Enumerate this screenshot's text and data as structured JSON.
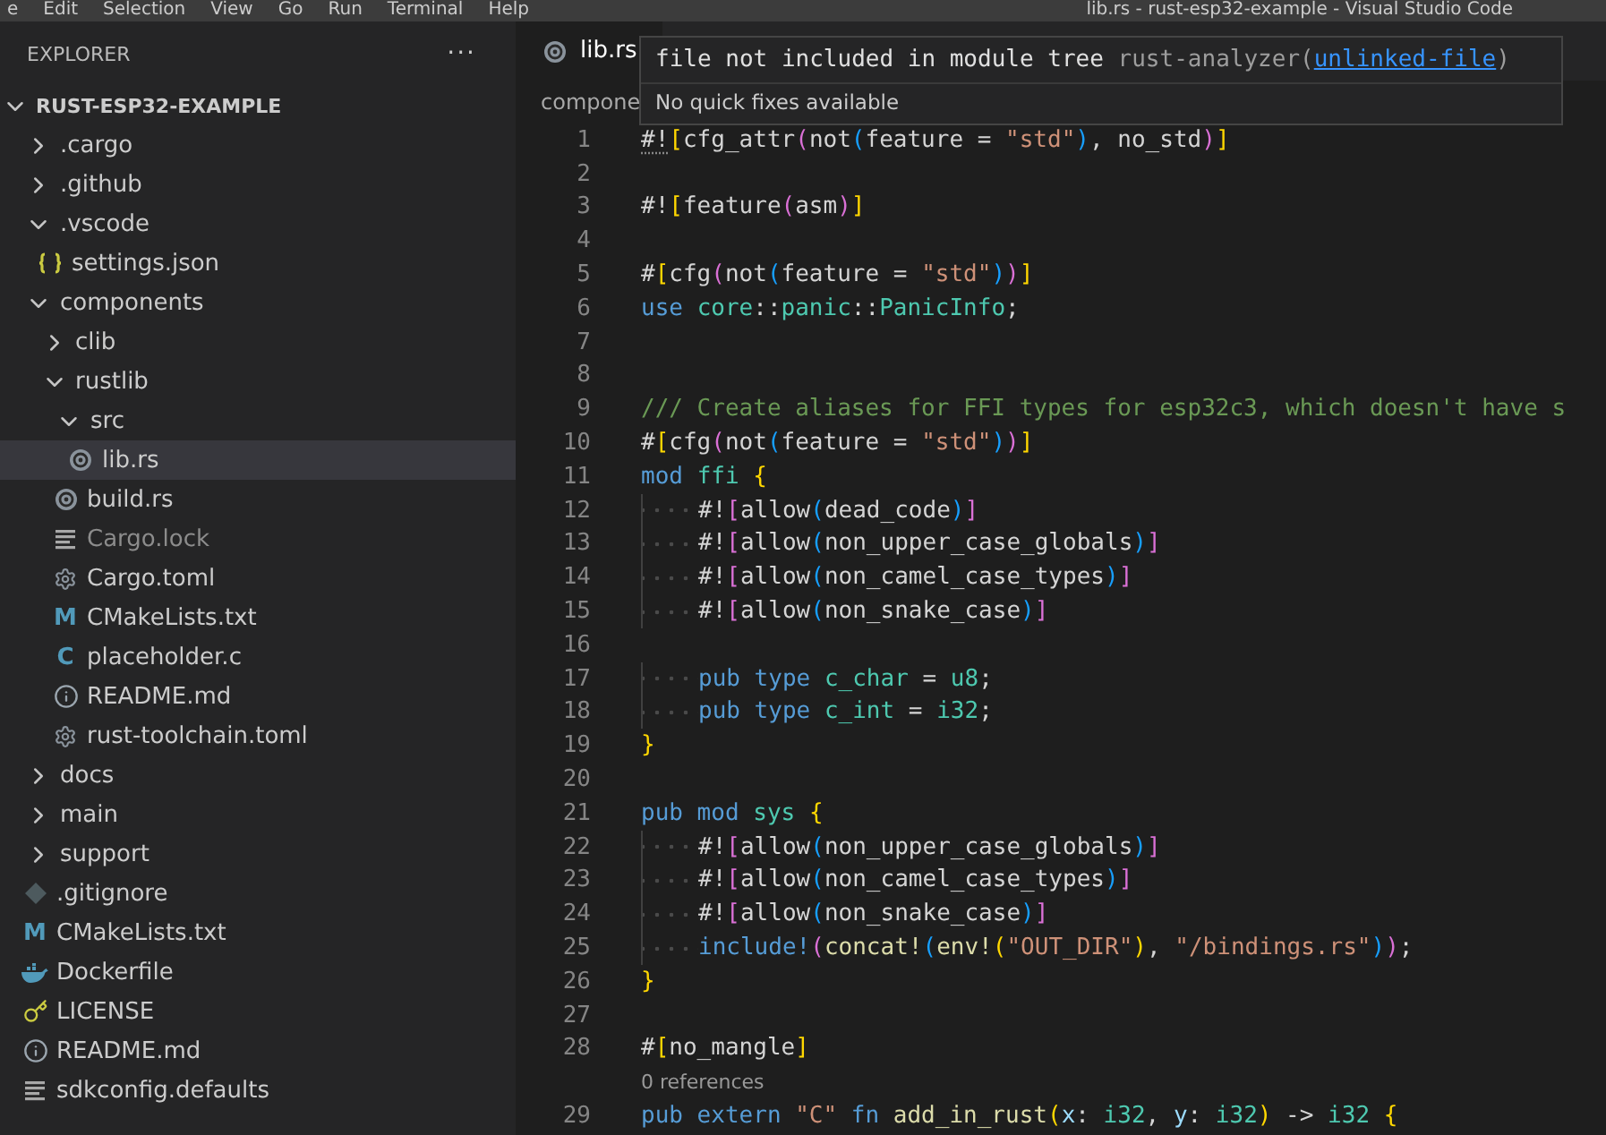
{
  "menu_bar": {
    "items": [
      "e",
      "Edit",
      "Selection",
      "View",
      "Go",
      "Run",
      "Terminal",
      "Help"
    ],
    "title": "lib.rs - rust-esp32-example - Visual Studio Code"
  },
  "sidebar": {
    "title": "EXPLORER",
    "more": "···",
    "root": {
      "name": "RUST-ESP32-EXAMPLE",
      "expanded": true
    },
    "tree": [
      {
        "name": ".cargo",
        "kind": "folder",
        "expanded": false,
        "selected": false,
        "dimmed": false
      },
      {
        "name": ".github",
        "kind": "folder",
        "expanded": false,
        "selected": false,
        "dimmed": false
      },
      {
        "name": ".vscode",
        "kind": "folder",
        "expanded": true,
        "selected": false,
        "dimmed": false,
        "children": [
          {
            "name": "settings.json",
            "kind": "json",
            "selected": false,
            "dimmed": false
          }
        ]
      },
      {
        "name": "components",
        "kind": "folder",
        "expanded": true,
        "selected": false,
        "dimmed": false,
        "children": [
          {
            "name": "clib",
            "kind": "folder",
            "expanded": false,
            "selected": false,
            "dimmed": false
          },
          {
            "name": "rustlib",
            "kind": "folder",
            "expanded": true,
            "selected": false,
            "dimmed": false,
            "children": [
              {
                "name": "src",
                "kind": "folder",
                "expanded": true,
                "selected": false,
                "dimmed": false,
                "children": [
                  {
                    "name": "lib.rs",
                    "kind": "rust",
                    "selected": true,
                    "dimmed": false
                  }
                ]
              },
              {
                "name": "build.rs",
                "kind": "rust",
                "selected": false,
                "dimmed": false
              },
              {
                "name": "Cargo.lock",
                "kind": "lines",
                "selected": false,
                "dimmed": true
              },
              {
                "name": "Cargo.toml",
                "kind": "gear",
                "selected": false,
                "dimmed": false
              },
              {
                "name": "CMakeLists.txt",
                "kind": "cmake",
                "icon_text": "M",
                "selected": false,
                "dimmed": false
              },
              {
                "name": "placeholder.c",
                "kind": "c",
                "icon_text": "C",
                "selected": false,
                "dimmed": false
              },
              {
                "name": "README.md",
                "kind": "info",
                "selected": false,
                "dimmed": false
              },
              {
                "name": "rust-toolchain.toml",
                "kind": "gear",
                "selected": false,
                "dimmed": false
              }
            ]
          }
        ]
      },
      {
        "name": "docs",
        "kind": "folder",
        "expanded": false,
        "selected": false,
        "dimmed": false
      },
      {
        "name": "main",
        "kind": "folder",
        "expanded": false,
        "selected": false,
        "dimmed": false
      },
      {
        "name": "support",
        "kind": "folder",
        "expanded": false,
        "selected": false,
        "dimmed": false
      },
      {
        "name": ".gitignore",
        "kind": "git",
        "selected": false,
        "dimmed": false
      },
      {
        "name": "CMakeLists.txt",
        "kind": "cmake",
        "icon_text": "M",
        "selected": false,
        "dimmed": false
      },
      {
        "name": "Dockerfile",
        "kind": "docker",
        "selected": false,
        "dimmed": false
      },
      {
        "name": "LICENSE",
        "kind": "license",
        "selected": false,
        "dimmed": false
      },
      {
        "name": "README.md",
        "kind": "info",
        "selected": false,
        "dimmed": false
      },
      {
        "name": "sdkconfig.defaults",
        "kind": "lines",
        "selected": false,
        "dimmed": false
      }
    ]
  },
  "tabs": [
    {
      "label": "lib.rs",
      "selected": true
    }
  ],
  "breadcrumb": "compone",
  "hover": {
    "message": "file not included in module tree",
    "source": "rust-analyzer(",
    "code": "unlinked-file",
    "close": ")",
    "status": "No quick fixes available"
  },
  "lines": [
    {
      "number": "1",
      "indent": false,
      "tokens": [
        {
          "kind": "hint",
          "text": "#!"
        },
        {
          "kind": "b1",
          "text": "["
        },
        {
          "kind": "t",
          "text": "cfg_attr"
        },
        {
          "kind": "b2",
          "text": "("
        },
        {
          "kind": "t",
          "text": "not"
        },
        {
          "kind": "b3",
          "text": "("
        },
        {
          "kind": "t",
          "text": "feature = "
        },
        {
          "kind": "s",
          "text": "\"std\""
        },
        {
          "kind": "b3",
          "text": ")"
        },
        {
          "kind": "t",
          "text": ", no_std"
        },
        {
          "kind": "b2",
          "text": ")"
        },
        {
          "kind": "b1",
          "text": "]"
        }
      ]
    },
    {
      "number": "2",
      "indent": false
    },
    {
      "number": "3",
      "indent": false,
      "tokens": [
        {
          "kind": "t",
          "text": "#!"
        },
        {
          "kind": "b1",
          "text": "["
        },
        {
          "kind": "t",
          "text": "feature"
        },
        {
          "kind": "b2",
          "text": "("
        },
        {
          "kind": "t",
          "text": "asm"
        },
        {
          "kind": "b2",
          "text": ")"
        },
        {
          "kind": "b1",
          "text": "]"
        }
      ]
    },
    {
      "number": "4",
      "indent": false
    },
    {
      "number": "5",
      "indent": false,
      "tokens": [
        {
          "kind": "t",
          "text": "#"
        },
        {
          "kind": "b1",
          "text": "["
        },
        {
          "kind": "t",
          "text": "cfg"
        },
        {
          "kind": "b2",
          "text": "("
        },
        {
          "kind": "t",
          "text": "not"
        },
        {
          "kind": "b3",
          "text": "("
        },
        {
          "kind": "t",
          "text": "feature = "
        },
        {
          "kind": "s",
          "text": "\"std\""
        },
        {
          "kind": "b3",
          "text": ")"
        },
        {
          "kind": "b2",
          "text": ")"
        },
        {
          "kind": "b1",
          "text": "]"
        }
      ]
    },
    {
      "number": "6",
      "indent": false,
      "tokens": [
        {
          "kind": "k",
          "text": "use "
        },
        {
          "kind": "n",
          "text": "core"
        },
        {
          "kind": "t",
          "text": "::"
        },
        {
          "kind": "n",
          "text": "panic"
        },
        {
          "kind": "t",
          "text": "::"
        },
        {
          "kind": "n",
          "text": "PanicInfo"
        },
        {
          "kind": "t",
          "text": ";"
        }
      ]
    },
    {
      "number": "7",
      "indent": false
    },
    {
      "number": "8",
      "indent": false
    },
    {
      "number": "9",
      "indent": false,
      "tokens": [
        {
          "kind": "c",
          "text": "/// Create aliases for FFI types for esp32c3, which doesn't have s"
        }
      ]
    },
    {
      "number": "10",
      "indent": false,
      "tokens": [
        {
          "kind": "t",
          "text": "#"
        },
        {
          "kind": "b1",
          "text": "["
        },
        {
          "kind": "t",
          "text": "cfg"
        },
        {
          "kind": "b2",
          "text": "("
        },
        {
          "kind": "t",
          "text": "not"
        },
        {
          "kind": "b3",
          "text": "("
        },
        {
          "kind": "t",
          "text": "feature = "
        },
        {
          "kind": "s",
          "text": "\"std\""
        },
        {
          "kind": "b3",
          "text": ")"
        },
        {
          "kind": "b2",
          "text": ")"
        },
        {
          "kind": "b1",
          "text": "]"
        }
      ]
    },
    {
      "number": "11",
      "indent": false,
      "tokens": [
        {
          "kind": "k",
          "text": "mod "
        },
        {
          "kind": "n",
          "text": "ffi "
        },
        {
          "kind": "b1",
          "text": "{"
        }
      ]
    },
    {
      "number": "12",
      "indent": true,
      "tokens": [
        {
          "kind": "t",
          "text": "#!"
        },
        {
          "kind": "b2",
          "text": "["
        },
        {
          "kind": "t",
          "text": "allow"
        },
        {
          "kind": "b3",
          "text": "("
        },
        {
          "kind": "t",
          "text": "dead_code"
        },
        {
          "kind": "b3",
          "text": ")"
        },
        {
          "kind": "b2",
          "text": "]"
        }
      ]
    },
    {
      "number": "13",
      "indent": true,
      "tokens": [
        {
          "kind": "t",
          "text": "#!"
        },
        {
          "kind": "b2",
          "text": "["
        },
        {
          "kind": "t",
          "text": "allow"
        },
        {
          "kind": "b3",
          "text": "("
        },
        {
          "kind": "t",
          "text": "non_upper_case_globals"
        },
        {
          "kind": "b3",
          "text": ")"
        },
        {
          "kind": "b2",
          "text": "]"
        }
      ]
    },
    {
      "number": "14",
      "indent": true,
      "tokens": [
        {
          "kind": "t",
          "text": "#!"
        },
        {
          "kind": "b2",
          "text": "["
        },
        {
          "kind": "t",
          "text": "allow"
        },
        {
          "kind": "b3",
          "text": "("
        },
        {
          "kind": "t",
          "text": "non_camel_case_types"
        },
        {
          "kind": "b3",
          "text": ")"
        },
        {
          "kind": "b2",
          "text": "]"
        }
      ]
    },
    {
      "number": "15",
      "indent": true,
      "tokens": [
        {
          "kind": "t",
          "text": "#!"
        },
        {
          "kind": "b2",
          "text": "["
        },
        {
          "kind": "t",
          "text": "allow"
        },
        {
          "kind": "b3",
          "text": "("
        },
        {
          "kind": "t",
          "text": "non_snake_case"
        },
        {
          "kind": "b3",
          "text": ")"
        },
        {
          "kind": "b2",
          "text": "]"
        }
      ]
    },
    {
      "number": "16",
      "indent": false
    },
    {
      "number": "17",
      "indent": true,
      "tokens": [
        {
          "kind": "k",
          "text": "pub type "
        },
        {
          "kind": "n",
          "text": "c_char"
        },
        {
          "kind": "t",
          "text": " = "
        },
        {
          "kind": "n",
          "text": "u8"
        },
        {
          "kind": "t",
          "text": ";"
        }
      ]
    },
    {
      "number": "18",
      "indent": true,
      "tokens": [
        {
          "kind": "k",
          "text": "pub type "
        },
        {
          "kind": "n",
          "text": "c_int"
        },
        {
          "kind": "t",
          "text": " = "
        },
        {
          "kind": "n",
          "text": "i32"
        },
        {
          "kind": "t",
          "text": ";"
        }
      ]
    },
    {
      "number": "19",
      "indent": false,
      "tokens": [
        {
          "kind": "b1",
          "text": "}"
        }
      ]
    },
    {
      "number": "20",
      "indent": false
    },
    {
      "number": "21",
      "indent": false,
      "tokens": [
        {
          "kind": "k",
          "text": "pub mod "
        },
        {
          "kind": "n",
          "text": "sys "
        },
        {
          "kind": "b1",
          "text": "{"
        }
      ]
    },
    {
      "number": "22",
      "indent": true,
      "tokens": [
        {
          "kind": "t",
          "text": "#!"
        },
        {
          "kind": "b2",
          "text": "["
        },
        {
          "kind": "t",
          "text": "allow"
        },
        {
          "kind": "b3",
          "text": "("
        },
        {
          "kind": "t",
          "text": "non_upper_case_globals"
        },
        {
          "kind": "b3",
          "text": ")"
        },
        {
          "kind": "b2",
          "text": "]"
        }
      ]
    },
    {
      "number": "23",
      "indent": true,
      "tokens": [
        {
          "kind": "t",
          "text": "#!"
        },
        {
          "kind": "b2",
          "text": "["
        },
        {
          "kind": "t",
          "text": "allow"
        },
        {
          "kind": "b3",
          "text": "("
        },
        {
          "kind": "t",
          "text": "non_camel_case_types"
        },
        {
          "kind": "b3",
          "text": ")"
        },
        {
          "kind": "b2",
          "text": "]"
        }
      ]
    },
    {
      "number": "24",
      "indent": true,
      "tokens": [
        {
          "kind": "t",
          "text": "#!"
        },
        {
          "kind": "b2",
          "text": "["
        },
        {
          "kind": "t",
          "text": "allow"
        },
        {
          "kind": "b3",
          "text": "("
        },
        {
          "kind": "t",
          "text": "non_snake_case"
        },
        {
          "kind": "b3",
          "text": ")"
        },
        {
          "kind": "b2",
          "text": "]"
        }
      ]
    },
    {
      "number": "25",
      "indent": true,
      "tokens": [
        {
          "kind": "k",
          "text": "include!"
        },
        {
          "kind": "b2",
          "text": "("
        },
        {
          "kind": "f",
          "text": "concat!"
        },
        {
          "kind": "b3",
          "text": "("
        },
        {
          "kind": "f",
          "text": "env!"
        },
        {
          "kind": "b1",
          "text": "("
        },
        {
          "kind": "s",
          "text": "\"OUT_DIR\""
        },
        {
          "kind": "b1",
          "text": ")"
        },
        {
          "kind": "t",
          "text": ", "
        },
        {
          "kind": "s",
          "text": "\"/bindings.rs\""
        },
        {
          "kind": "b3",
          "text": ")"
        },
        {
          "kind": "b2",
          "text": ")"
        },
        {
          "kind": "t",
          "text": ";"
        }
      ]
    },
    {
      "number": "26",
      "indent": false,
      "tokens": [
        {
          "kind": "b1",
          "text": "}"
        }
      ]
    },
    {
      "number": "27",
      "indent": false
    },
    {
      "number": "28",
      "indent": false,
      "codelens": "0 references",
      "tokens": [
        {
          "kind": "t",
          "text": "#"
        },
        {
          "kind": "b1",
          "text": "["
        },
        {
          "kind": "t",
          "text": "no_mangle"
        },
        {
          "kind": "b1",
          "text": "]"
        }
      ]
    },
    {
      "number": "29",
      "indent": false,
      "tokens": [
        {
          "kind": "k",
          "text": "pub extern "
        },
        {
          "kind": "s",
          "text": "\"C\" "
        },
        {
          "kind": "k",
          "text": "fn "
        },
        {
          "kind": "f",
          "text": "add_in_rust"
        },
        {
          "kind": "b1",
          "text": "("
        },
        {
          "kind": "v",
          "text": "x"
        },
        {
          "kind": "t",
          "text": ": "
        },
        {
          "kind": "n",
          "text": "i32"
        },
        {
          "kind": "t",
          "text": ", "
        },
        {
          "kind": "v",
          "text": "y"
        },
        {
          "kind": "t",
          "text": ": "
        },
        {
          "kind": "n",
          "text": "i32"
        },
        {
          "kind": "b1",
          "text": ")"
        },
        {
          "kind": "t",
          "text": " -> "
        },
        {
          "kind": "n",
          "text": "i32 "
        },
        {
          "kind": "b1",
          "text": "{"
        }
      ]
    }
  ]
}
